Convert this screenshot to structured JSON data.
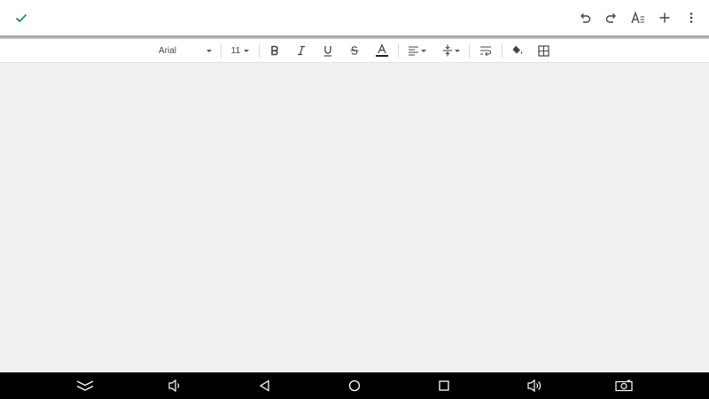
{
  "appbar": {
    "actions": {
      "done": "check-icon",
      "undo": "undo-icon",
      "redo": "redo-icon",
      "text_format": "text-format-icon",
      "insert": "plus-icon",
      "more": "more-vert-icon"
    }
  },
  "toolbar": {
    "font_family": "Arial",
    "font_size": "11"
  },
  "colors": {
    "accent": "#188038",
    "doc_background": "#f1f1f1",
    "navbar": "#000000"
  }
}
